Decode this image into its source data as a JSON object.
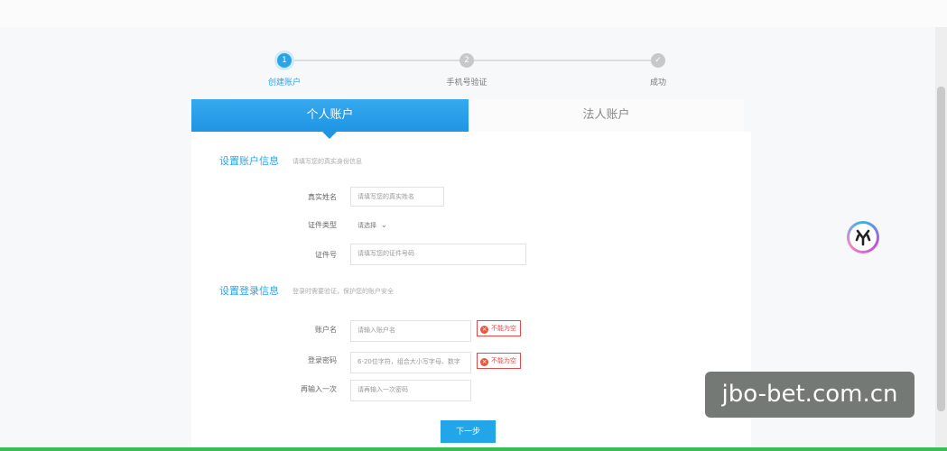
{
  "steps": [
    {
      "number": "1",
      "label": "创建账户",
      "state": "active"
    },
    {
      "number": "2",
      "label": "手机号验证",
      "state": "pending"
    },
    {
      "number": "✓",
      "label": "成功",
      "state": "pending"
    }
  ],
  "tabs": {
    "personal": "个人账户",
    "corporate": "法人账户",
    "selected": "personal"
  },
  "account_section": {
    "title": "设置账户信息",
    "hint": "请填写您的真实身份信息",
    "fields": {
      "real_name": {
        "label": "真实姓名",
        "placeholder": "请填写您的真实姓名"
      },
      "id_type": {
        "label": "证件类型",
        "value": "请选择"
      },
      "id_number": {
        "label": "证件号",
        "placeholder": "请填写您的证件号码"
      }
    }
  },
  "login_section": {
    "title": "设置登录信息",
    "hint": "登录时需要验证，保护您的账户安全",
    "fields": {
      "username": {
        "label": "账户名",
        "placeholder": "请输入账户名",
        "error": "不能为空"
      },
      "password": {
        "label": "登录密码",
        "placeholder": "6-20位字符，组合大小写字母、数字",
        "error": "不能为空"
      },
      "confirm_password": {
        "label": "再输入一次",
        "placeholder": "请再输入一次密码"
      }
    }
  },
  "next_button": "下一步",
  "watermark": "jbo-bet.com.cn",
  "colors": {
    "accent": "#23a6e9",
    "error": "#e34a4a"
  },
  "icons": {
    "floating_badge": "y-shaped-logo-icon",
    "error": "close-circle-icon",
    "select": "chevron-down-icon"
  }
}
